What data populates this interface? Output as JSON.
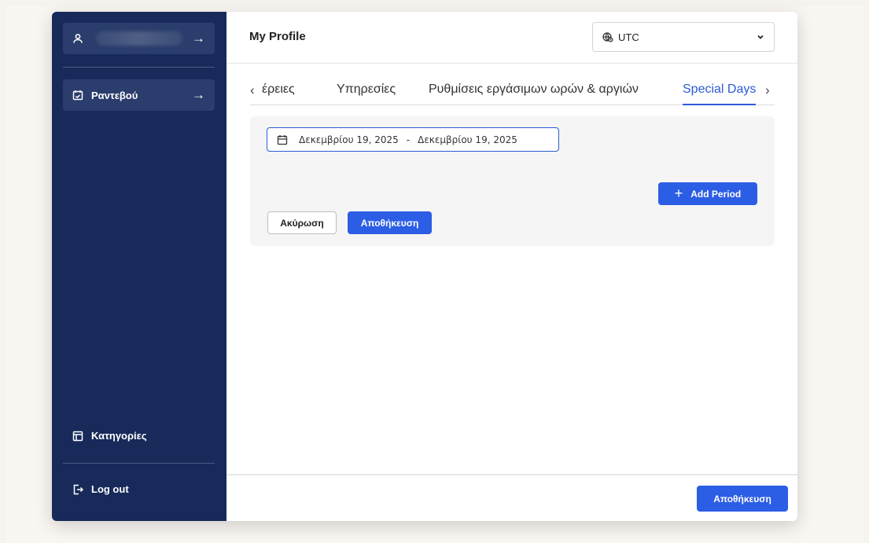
{
  "sidebar": {
    "profile_button": {
      "icon": "user-icon",
      "arrow": "→"
    },
    "appointments": {
      "label": "Ραντεβού",
      "icon": "calendar-icon",
      "arrow": "→"
    },
    "categories": {
      "label": "Κατηγορίες",
      "icon": "list-icon"
    },
    "logout": {
      "label": "Log out",
      "icon": "logout-icon"
    }
  },
  "header": {
    "title": "My Profile",
    "timezone": {
      "value": "UTC",
      "icon": "globe-icon"
    }
  },
  "tabs": {
    "prev_arrow": "‹",
    "next_arrow": "›",
    "items": [
      {
        "label": "έρειες",
        "active": false
      },
      {
        "label": "Υπηρεσίες",
        "active": false
      },
      {
        "label": "Ρυθμίσεις εργάσιμων ωρών & αργιών",
        "active": false
      },
      {
        "label": "Special Days",
        "active": true
      }
    ]
  },
  "special_days": {
    "date_range": {
      "start": "Δεκεμβρίου 19, 2025",
      "separator": "-",
      "end": "Δεκεμβρίου 19, 2025"
    },
    "add_period_label": "Add Period",
    "add_period_plus": "+",
    "cancel_label": "Ακύρωση",
    "save_label": "Αποθήκευση"
  },
  "footer": {
    "save_label": "Αποθήκευση"
  },
  "colors": {
    "sidebar_bg": "#172a5a",
    "sidebar_button_bg": "#2a3d6c",
    "accent": "#2c5de5",
    "active_tab": "#2b5bd7"
  }
}
